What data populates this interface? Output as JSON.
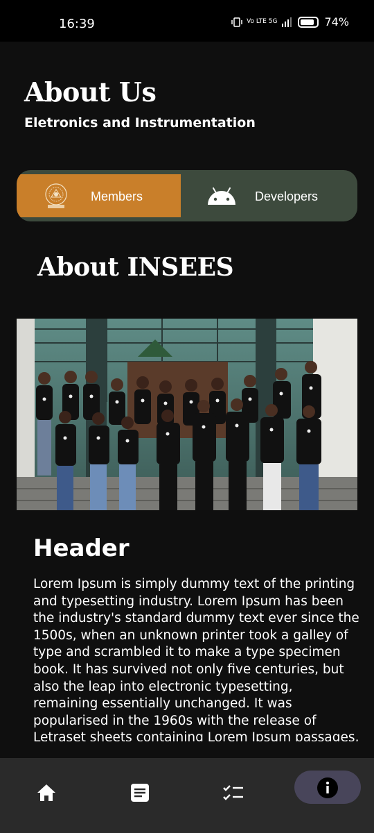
{
  "status_bar": {
    "time": "16:39",
    "network": "Vo LTE 5G",
    "battery": "74%"
  },
  "header": {
    "title": "About Us",
    "subtitle": "Eletronics and Instrumentation"
  },
  "toggle": {
    "members_label": "Members",
    "developers_label": "Developers",
    "selected": "Members",
    "accent_color": "#c97f2a",
    "bar_color": "#3d4a3d"
  },
  "section": {
    "title": "About INSEES"
  },
  "article": {
    "header": "Header",
    "body": "Lorem Ipsum is simply dummy text of the printing and typesetting industry. Lorem Ipsum has been the industry's standard dummy text ever since the 1500s, when an unknown printer took a galley of type and scrambled it to make a type specimen book. It has survived not only five centuries, but also the leap into electronic typesetting, remaining essentially unchanged. It was popularised in the 1960s with the release of Letraset sheets containing Lorem Ipsum passages, and more"
  },
  "bottom_nav": {
    "items": [
      {
        "icon": "home-icon"
      },
      {
        "icon": "article-icon"
      },
      {
        "icon": "checklist-icon"
      },
      {
        "icon": "info-icon",
        "active": true
      }
    ]
  }
}
